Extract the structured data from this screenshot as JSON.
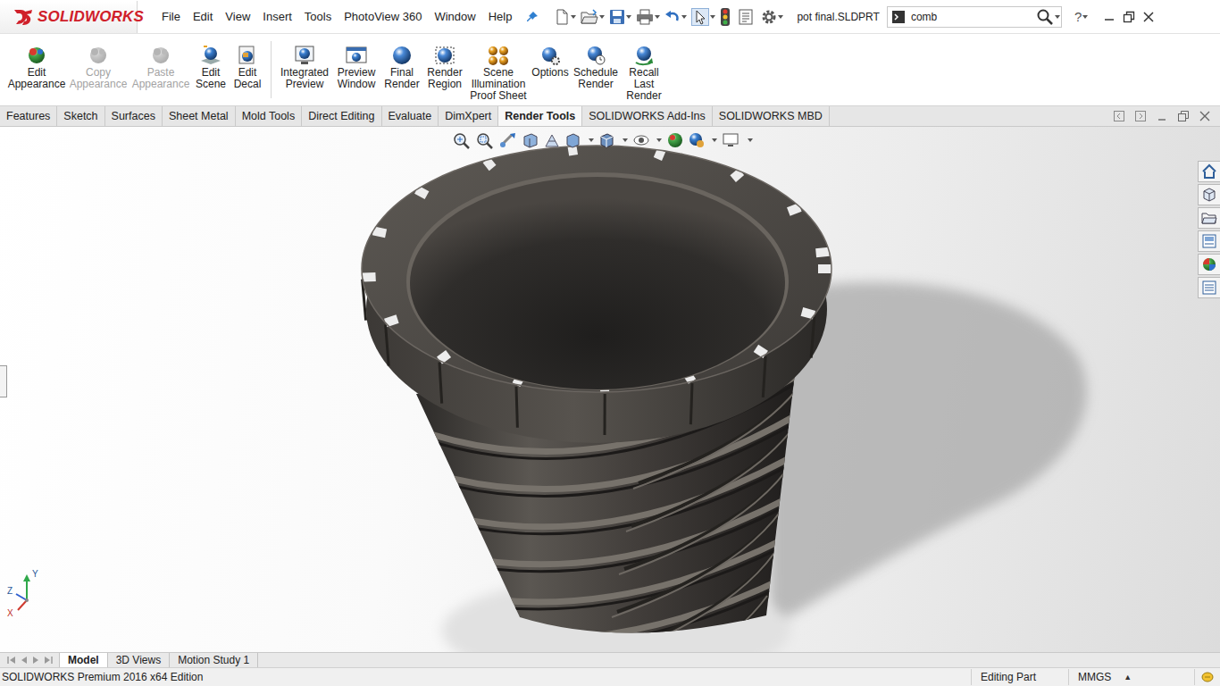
{
  "app": {
    "logo": "SOLIDWORKS",
    "title": "pot final.SLDPRT"
  },
  "menu": [
    "File",
    "Edit",
    "View",
    "Insert",
    "Tools",
    "PhotoView 360",
    "Window",
    "Help"
  ],
  "search": {
    "value": "comb"
  },
  "help": "?",
  "ribbon": [
    {
      "label": "Edit Appearance",
      "disabled": false
    },
    {
      "label": "Copy Appearance",
      "disabled": true
    },
    {
      "label": "Paste Appearance",
      "disabled": true
    },
    {
      "label": "Edit Scene",
      "disabled": false
    },
    {
      "label": "Edit Decal",
      "disabled": false
    },
    {
      "label": "Integrated Preview",
      "disabled": false
    },
    {
      "label": "Preview Window",
      "disabled": false
    },
    {
      "label": "Final Render",
      "disabled": false
    },
    {
      "label": "Render Region",
      "disabled": false
    },
    {
      "label": "Scene Illumination Proof Sheet",
      "disabled": false
    },
    {
      "label": "Options",
      "disabled": false
    },
    {
      "label": "Schedule Render",
      "disabled": false
    },
    {
      "label": "Recall Last Render",
      "disabled": false
    }
  ],
  "tabs": [
    {
      "label": "Features",
      "selected": false
    },
    {
      "label": "Sketch",
      "selected": false
    },
    {
      "label": "Surfaces",
      "selected": false
    },
    {
      "label": "Sheet Metal",
      "selected": false
    },
    {
      "label": "Mold Tools",
      "selected": false
    },
    {
      "label": "Direct Editing",
      "selected": false
    },
    {
      "label": "Evaluate",
      "selected": false
    },
    {
      "label": "DimXpert",
      "selected": false
    },
    {
      "label": "Render Tools",
      "selected": true
    },
    {
      "label": "SOLIDWORKS Add-Ins",
      "selected": false
    },
    {
      "label": "SOLIDWORKS MBD",
      "selected": false
    }
  ],
  "triad": {
    "y": "Y",
    "z": "Z",
    "x": "X"
  },
  "bottom_tabs": [
    {
      "label": "Model",
      "selected": true
    },
    {
      "label": "3D Views",
      "selected": false
    },
    {
      "label": "Motion Study 1",
      "selected": false
    }
  ],
  "status_bar": {
    "edition": "SOLIDWORKS Premium 2016 x64 Edition",
    "mode": "Editing Part",
    "units": "MMGS",
    "units_arrow": "▲"
  }
}
